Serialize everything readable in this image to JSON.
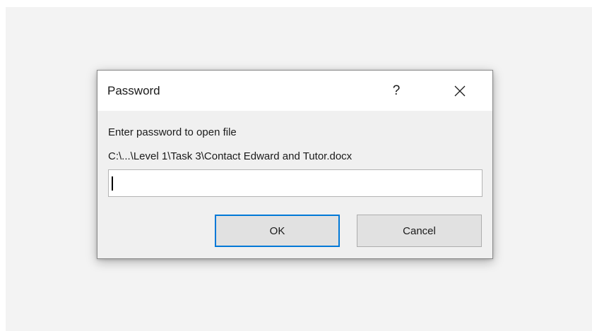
{
  "dialog": {
    "title": "Password",
    "help_label": "?",
    "prompt": "Enter password to open file",
    "file_path": "C:\\...\\Level 1\\Task 3\\Contact Edward and Tutor.docx",
    "password_value": "",
    "ok_label": "OK",
    "cancel_label": "Cancel"
  },
  "icons": {
    "help": "question-mark-icon",
    "close": "close-icon"
  },
  "colors": {
    "accent": "#0078d7",
    "dialog_bg": "#f0f0f0",
    "titlebar_bg": "#ffffff",
    "button_bg": "#e1e1e1"
  }
}
